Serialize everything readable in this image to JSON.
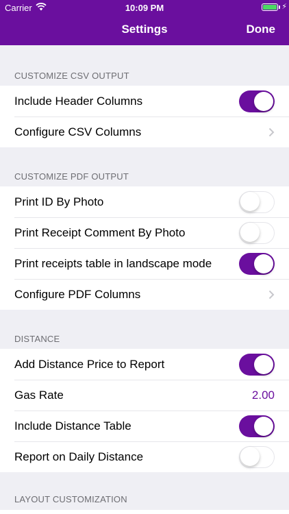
{
  "status_bar": {
    "carrier": "Carrier",
    "time": "10:09 PM"
  },
  "nav": {
    "title": "Settings",
    "done_label": "Done"
  },
  "colors": {
    "accent": "#6a0f9e",
    "background": "#efeff4",
    "battery": "#4cd964"
  },
  "sections": [
    {
      "header": "CUSTOMIZE CSV OUTPUT",
      "rows": [
        {
          "label": "Include Header Columns",
          "control": "toggle",
          "on": true
        },
        {
          "label": "Configure CSV Columns",
          "control": "chevron"
        }
      ]
    },
    {
      "header": "CUSTOMIZE PDF OUTPUT",
      "rows": [
        {
          "label": "Print ID By Photo",
          "control": "toggle",
          "on": false
        },
        {
          "label": "Print Receipt Comment By Photo",
          "control": "toggle",
          "on": false
        },
        {
          "label": "Print receipts table in landscape mode",
          "control": "toggle",
          "on": true
        },
        {
          "label": "Configure PDF Columns",
          "control": "chevron"
        }
      ]
    },
    {
      "header": "DISTANCE",
      "rows": [
        {
          "label": "Add Distance Price to Report",
          "control": "toggle",
          "on": true
        },
        {
          "label": "Gas Rate",
          "control": "value",
          "value": "2.00"
        },
        {
          "label": "Include Distance Table",
          "control": "toggle",
          "on": true
        },
        {
          "label": "Report on Daily Distance",
          "control": "toggle",
          "on": false
        }
      ]
    },
    {
      "header": "LAYOUT CUSTOMIZATION",
      "rows": []
    }
  ]
}
